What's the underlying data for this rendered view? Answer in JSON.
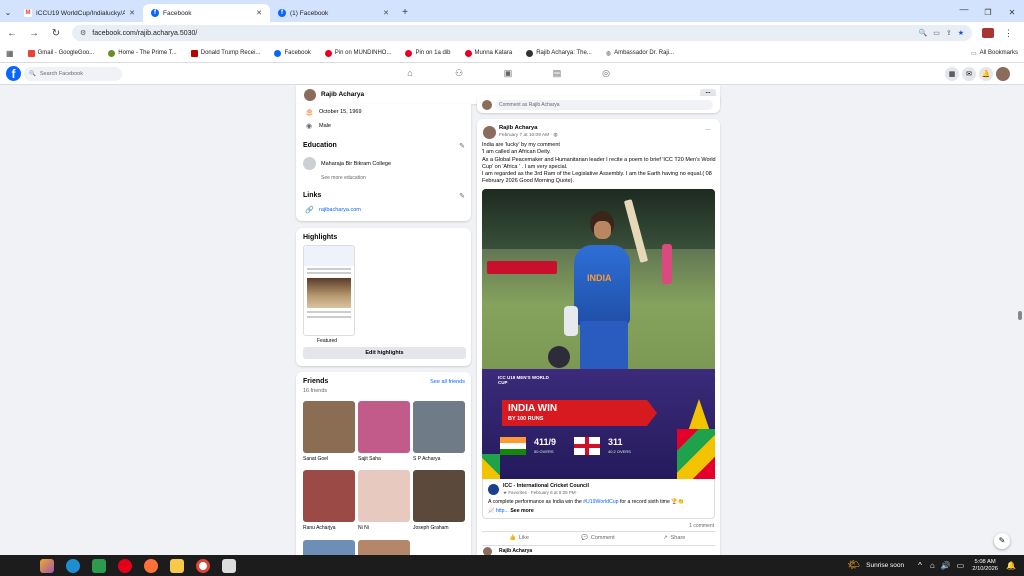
{
  "browser": {
    "tabs": [
      {
        "title": "ICCU19 WorldCup/Indialucky/A...",
        "icon": "gmail-icon"
      },
      {
        "title": "Facebook",
        "icon": "facebook-icon"
      },
      {
        "title": "(1) Facebook",
        "icon": "facebook-icon"
      }
    ],
    "url": "facebook.com/rajib.acharya.5030/",
    "bookmarks": [
      "Gmail - GoogleGoo...",
      "Home - The Prime T...",
      "Donald Trump Recei...",
      "Facebook",
      "Pin on MUNDINHO...",
      "Pin on 1a dib",
      "Munna Katara",
      "Rajib Acharya: The...",
      "Ambassador Dr. Raji..."
    ],
    "all_bookmarks": "All Bookmarks"
  },
  "fb": {
    "search_placeholder": "Search Facebook",
    "profile_name": "Rajib Acharya",
    "dots": "..."
  },
  "about": {
    "birthday": "October 15, 1969",
    "gender": "Male",
    "education_heading": "Education",
    "college": "Maharaja Bir Bikram College",
    "see_more_education": "See more education",
    "links_heading": "Links",
    "link": "rajibacharya.com"
  },
  "highlights": {
    "heading": "Highlights",
    "featured": "Featured",
    "edit": "Edit highlights"
  },
  "friends": {
    "heading": "Friends",
    "see_all": "See all friends",
    "count": "16 friends",
    "list": [
      {
        "name": "Sanat Goel",
        "color": "#8a6d52"
      },
      {
        "name": "Sajit Saha",
        "color": "#c25b8a"
      },
      {
        "name": "S P Acharya",
        "color": "#6f7b86"
      },
      {
        "name": "Ranu Acharjya",
        "color": "#9c4a45"
      },
      {
        "name": "Ni Ni",
        "color": "#e7c9c0"
      },
      {
        "name": "Joseph Graham",
        "color": "#5b4a3c"
      }
    ]
  },
  "prev_post": {
    "comment_as": "Comment as Rajib Acharya"
  },
  "post": {
    "author": "Rajib Acharya",
    "time": "February 7 at 10:09 AM ·",
    "lines": [
      "India are 'lucky' by my comment",
      "'I am called an African Deity.",
      "As a Global Peacemaker and Humanitarian leader I recite a poem to brief 'ICC T20 Men's World",
      "Cup' on 'Africa ' . I am very special.",
      "I am regarded as the 3rd Ram of the Legislative Assembly. I am the Earth having no equal.( 08",
      "February 2026 Good Morning Quote)."
    ],
    "image": {
      "event": "ICC U19 MEN'S WORLD CUP",
      "headline": "INDIA WIN",
      "sub": "BY 100 RUNS",
      "india_score": "411/9",
      "india_overs": "50 OVERS",
      "eng_score": "311",
      "eng_overs": "40.2 OVERS",
      "board": "INDIA"
    },
    "shared_author": "ICC - International Cricket Council",
    "shared_meta": "Favorites · February 6 at 8:25 PM ·",
    "shared_text_pre": "A complete performance as India win the ",
    "shared_hashtag": "#U19WorldCup",
    "shared_text_post": " for a record sixth time 🏆👏",
    "shared_link": "📈 http...",
    "see_more": "See more",
    "comments": "1 comment",
    "like": "Like",
    "comment": "Comment",
    "share": "Share",
    "next_author": "Rajib Acharya"
  },
  "taskbar": {
    "weather": "Sunrise soon",
    "time": "5:08 AM",
    "date": "2/10/2026"
  }
}
